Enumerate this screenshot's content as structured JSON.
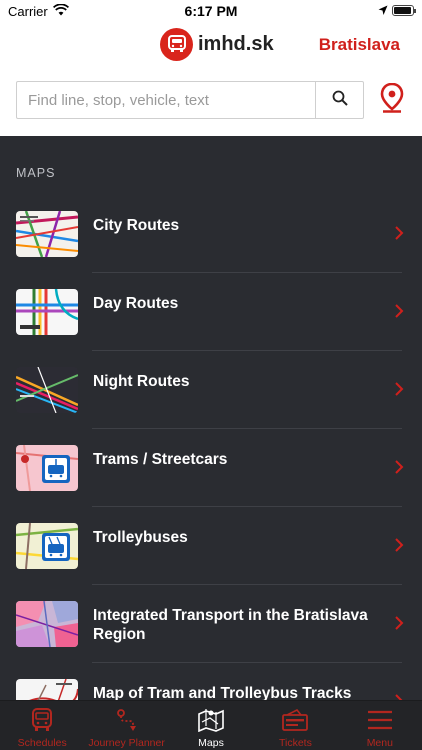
{
  "status": {
    "carrier": "Carrier",
    "time": "6:17 PM"
  },
  "header": {
    "logo_text": "imhd.sk",
    "city": "Bratislava"
  },
  "search": {
    "placeholder": "Find line, stop, vehicle, text"
  },
  "section": {
    "title": "MAPS"
  },
  "maps": [
    {
      "label": "City Routes",
      "thumb": "city-routes"
    },
    {
      "label": "Day Routes",
      "thumb": "day-routes"
    },
    {
      "label": "Night Routes",
      "thumb": "night-routes"
    },
    {
      "label": "Trams / Streetcars",
      "thumb": "trams"
    },
    {
      "label": "Trolleybuses",
      "thumb": "trolleybuses"
    },
    {
      "label": "Integrated Transport in the Bratislava Region",
      "thumb": "integrated"
    },
    {
      "label": "Map of Tram and Trolleybus Tracks",
      "thumb": "tracks"
    }
  ],
  "tabs": [
    {
      "label": "Schedules",
      "icon": "bus-icon"
    },
    {
      "label": "Journey Planner",
      "icon": "route-icon"
    },
    {
      "label": "Maps",
      "icon": "map-icon",
      "active": true
    },
    {
      "label": "Tickets",
      "icon": "ticket-icon"
    },
    {
      "label": "Menu",
      "icon": "menu-icon"
    }
  ],
  "colors": {
    "accent": "#d0201c",
    "background": "#2a2c31",
    "tabbar": "#232427"
  }
}
